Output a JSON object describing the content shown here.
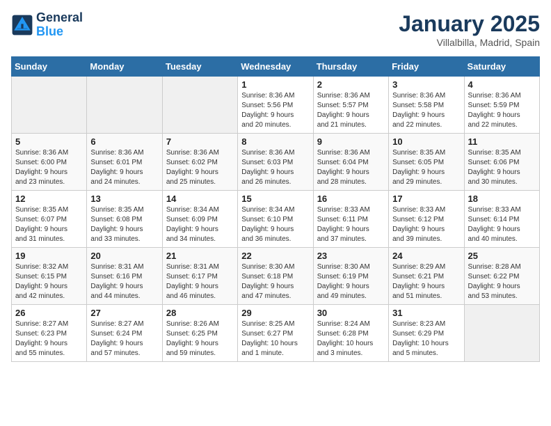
{
  "header": {
    "logo_general": "General",
    "logo_blue": "Blue",
    "month": "January 2025",
    "location": "Villalbilla, Madrid, Spain"
  },
  "days_of_week": [
    "Sunday",
    "Monday",
    "Tuesday",
    "Wednesday",
    "Thursday",
    "Friday",
    "Saturday"
  ],
  "weeks": [
    [
      {
        "day": "",
        "info": ""
      },
      {
        "day": "",
        "info": ""
      },
      {
        "day": "",
        "info": ""
      },
      {
        "day": "1",
        "info": "Sunrise: 8:36 AM\nSunset: 5:56 PM\nDaylight: 9 hours\nand 20 minutes."
      },
      {
        "day": "2",
        "info": "Sunrise: 8:36 AM\nSunset: 5:57 PM\nDaylight: 9 hours\nand 21 minutes."
      },
      {
        "day": "3",
        "info": "Sunrise: 8:36 AM\nSunset: 5:58 PM\nDaylight: 9 hours\nand 22 minutes."
      },
      {
        "day": "4",
        "info": "Sunrise: 8:36 AM\nSunset: 5:59 PM\nDaylight: 9 hours\nand 22 minutes."
      }
    ],
    [
      {
        "day": "5",
        "info": "Sunrise: 8:36 AM\nSunset: 6:00 PM\nDaylight: 9 hours\nand 23 minutes."
      },
      {
        "day": "6",
        "info": "Sunrise: 8:36 AM\nSunset: 6:01 PM\nDaylight: 9 hours\nand 24 minutes."
      },
      {
        "day": "7",
        "info": "Sunrise: 8:36 AM\nSunset: 6:02 PM\nDaylight: 9 hours\nand 25 minutes."
      },
      {
        "day": "8",
        "info": "Sunrise: 8:36 AM\nSunset: 6:03 PM\nDaylight: 9 hours\nand 26 minutes."
      },
      {
        "day": "9",
        "info": "Sunrise: 8:36 AM\nSunset: 6:04 PM\nDaylight: 9 hours\nand 28 minutes."
      },
      {
        "day": "10",
        "info": "Sunrise: 8:35 AM\nSunset: 6:05 PM\nDaylight: 9 hours\nand 29 minutes."
      },
      {
        "day": "11",
        "info": "Sunrise: 8:35 AM\nSunset: 6:06 PM\nDaylight: 9 hours\nand 30 minutes."
      }
    ],
    [
      {
        "day": "12",
        "info": "Sunrise: 8:35 AM\nSunset: 6:07 PM\nDaylight: 9 hours\nand 31 minutes."
      },
      {
        "day": "13",
        "info": "Sunrise: 8:35 AM\nSunset: 6:08 PM\nDaylight: 9 hours\nand 33 minutes."
      },
      {
        "day": "14",
        "info": "Sunrise: 8:34 AM\nSunset: 6:09 PM\nDaylight: 9 hours\nand 34 minutes."
      },
      {
        "day": "15",
        "info": "Sunrise: 8:34 AM\nSunset: 6:10 PM\nDaylight: 9 hours\nand 36 minutes."
      },
      {
        "day": "16",
        "info": "Sunrise: 8:33 AM\nSunset: 6:11 PM\nDaylight: 9 hours\nand 37 minutes."
      },
      {
        "day": "17",
        "info": "Sunrise: 8:33 AM\nSunset: 6:12 PM\nDaylight: 9 hours\nand 39 minutes."
      },
      {
        "day": "18",
        "info": "Sunrise: 8:33 AM\nSunset: 6:14 PM\nDaylight: 9 hours\nand 40 minutes."
      }
    ],
    [
      {
        "day": "19",
        "info": "Sunrise: 8:32 AM\nSunset: 6:15 PM\nDaylight: 9 hours\nand 42 minutes."
      },
      {
        "day": "20",
        "info": "Sunrise: 8:31 AM\nSunset: 6:16 PM\nDaylight: 9 hours\nand 44 minutes."
      },
      {
        "day": "21",
        "info": "Sunrise: 8:31 AM\nSunset: 6:17 PM\nDaylight: 9 hours\nand 46 minutes."
      },
      {
        "day": "22",
        "info": "Sunrise: 8:30 AM\nSunset: 6:18 PM\nDaylight: 9 hours\nand 47 minutes."
      },
      {
        "day": "23",
        "info": "Sunrise: 8:30 AM\nSunset: 6:19 PM\nDaylight: 9 hours\nand 49 minutes."
      },
      {
        "day": "24",
        "info": "Sunrise: 8:29 AM\nSunset: 6:21 PM\nDaylight: 9 hours\nand 51 minutes."
      },
      {
        "day": "25",
        "info": "Sunrise: 8:28 AM\nSunset: 6:22 PM\nDaylight: 9 hours\nand 53 minutes."
      }
    ],
    [
      {
        "day": "26",
        "info": "Sunrise: 8:27 AM\nSunset: 6:23 PM\nDaylight: 9 hours\nand 55 minutes."
      },
      {
        "day": "27",
        "info": "Sunrise: 8:27 AM\nSunset: 6:24 PM\nDaylight: 9 hours\nand 57 minutes."
      },
      {
        "day": "28",
        "info": "Sunrise: 8:26 AM\nSunset: 6:25 PM\nDaylight: 9 hours\nand 59 minutes."
      },
      {
        "day": "29",
        "info": "Sunrise: 8:25 AM\nSunset: 6:27 PM\nDaylight: 10 hours\nand 1 minute."
      },
      {
        "day": "30",
        "info": "Sunrise: 8:24 AM\nSunset: 6:28 PM\nDaylight: 10 hours\nand 3 minutes."
      },
      {
        "day": "31",
        "info": "Sunrise: 8:23 AM\nSunset: 6:29 PM\nDaylight: 10 hours\nand 5 minutes."
      },
      {
        "day": "",
        "info": ""
      }
    ]
  ]
}
